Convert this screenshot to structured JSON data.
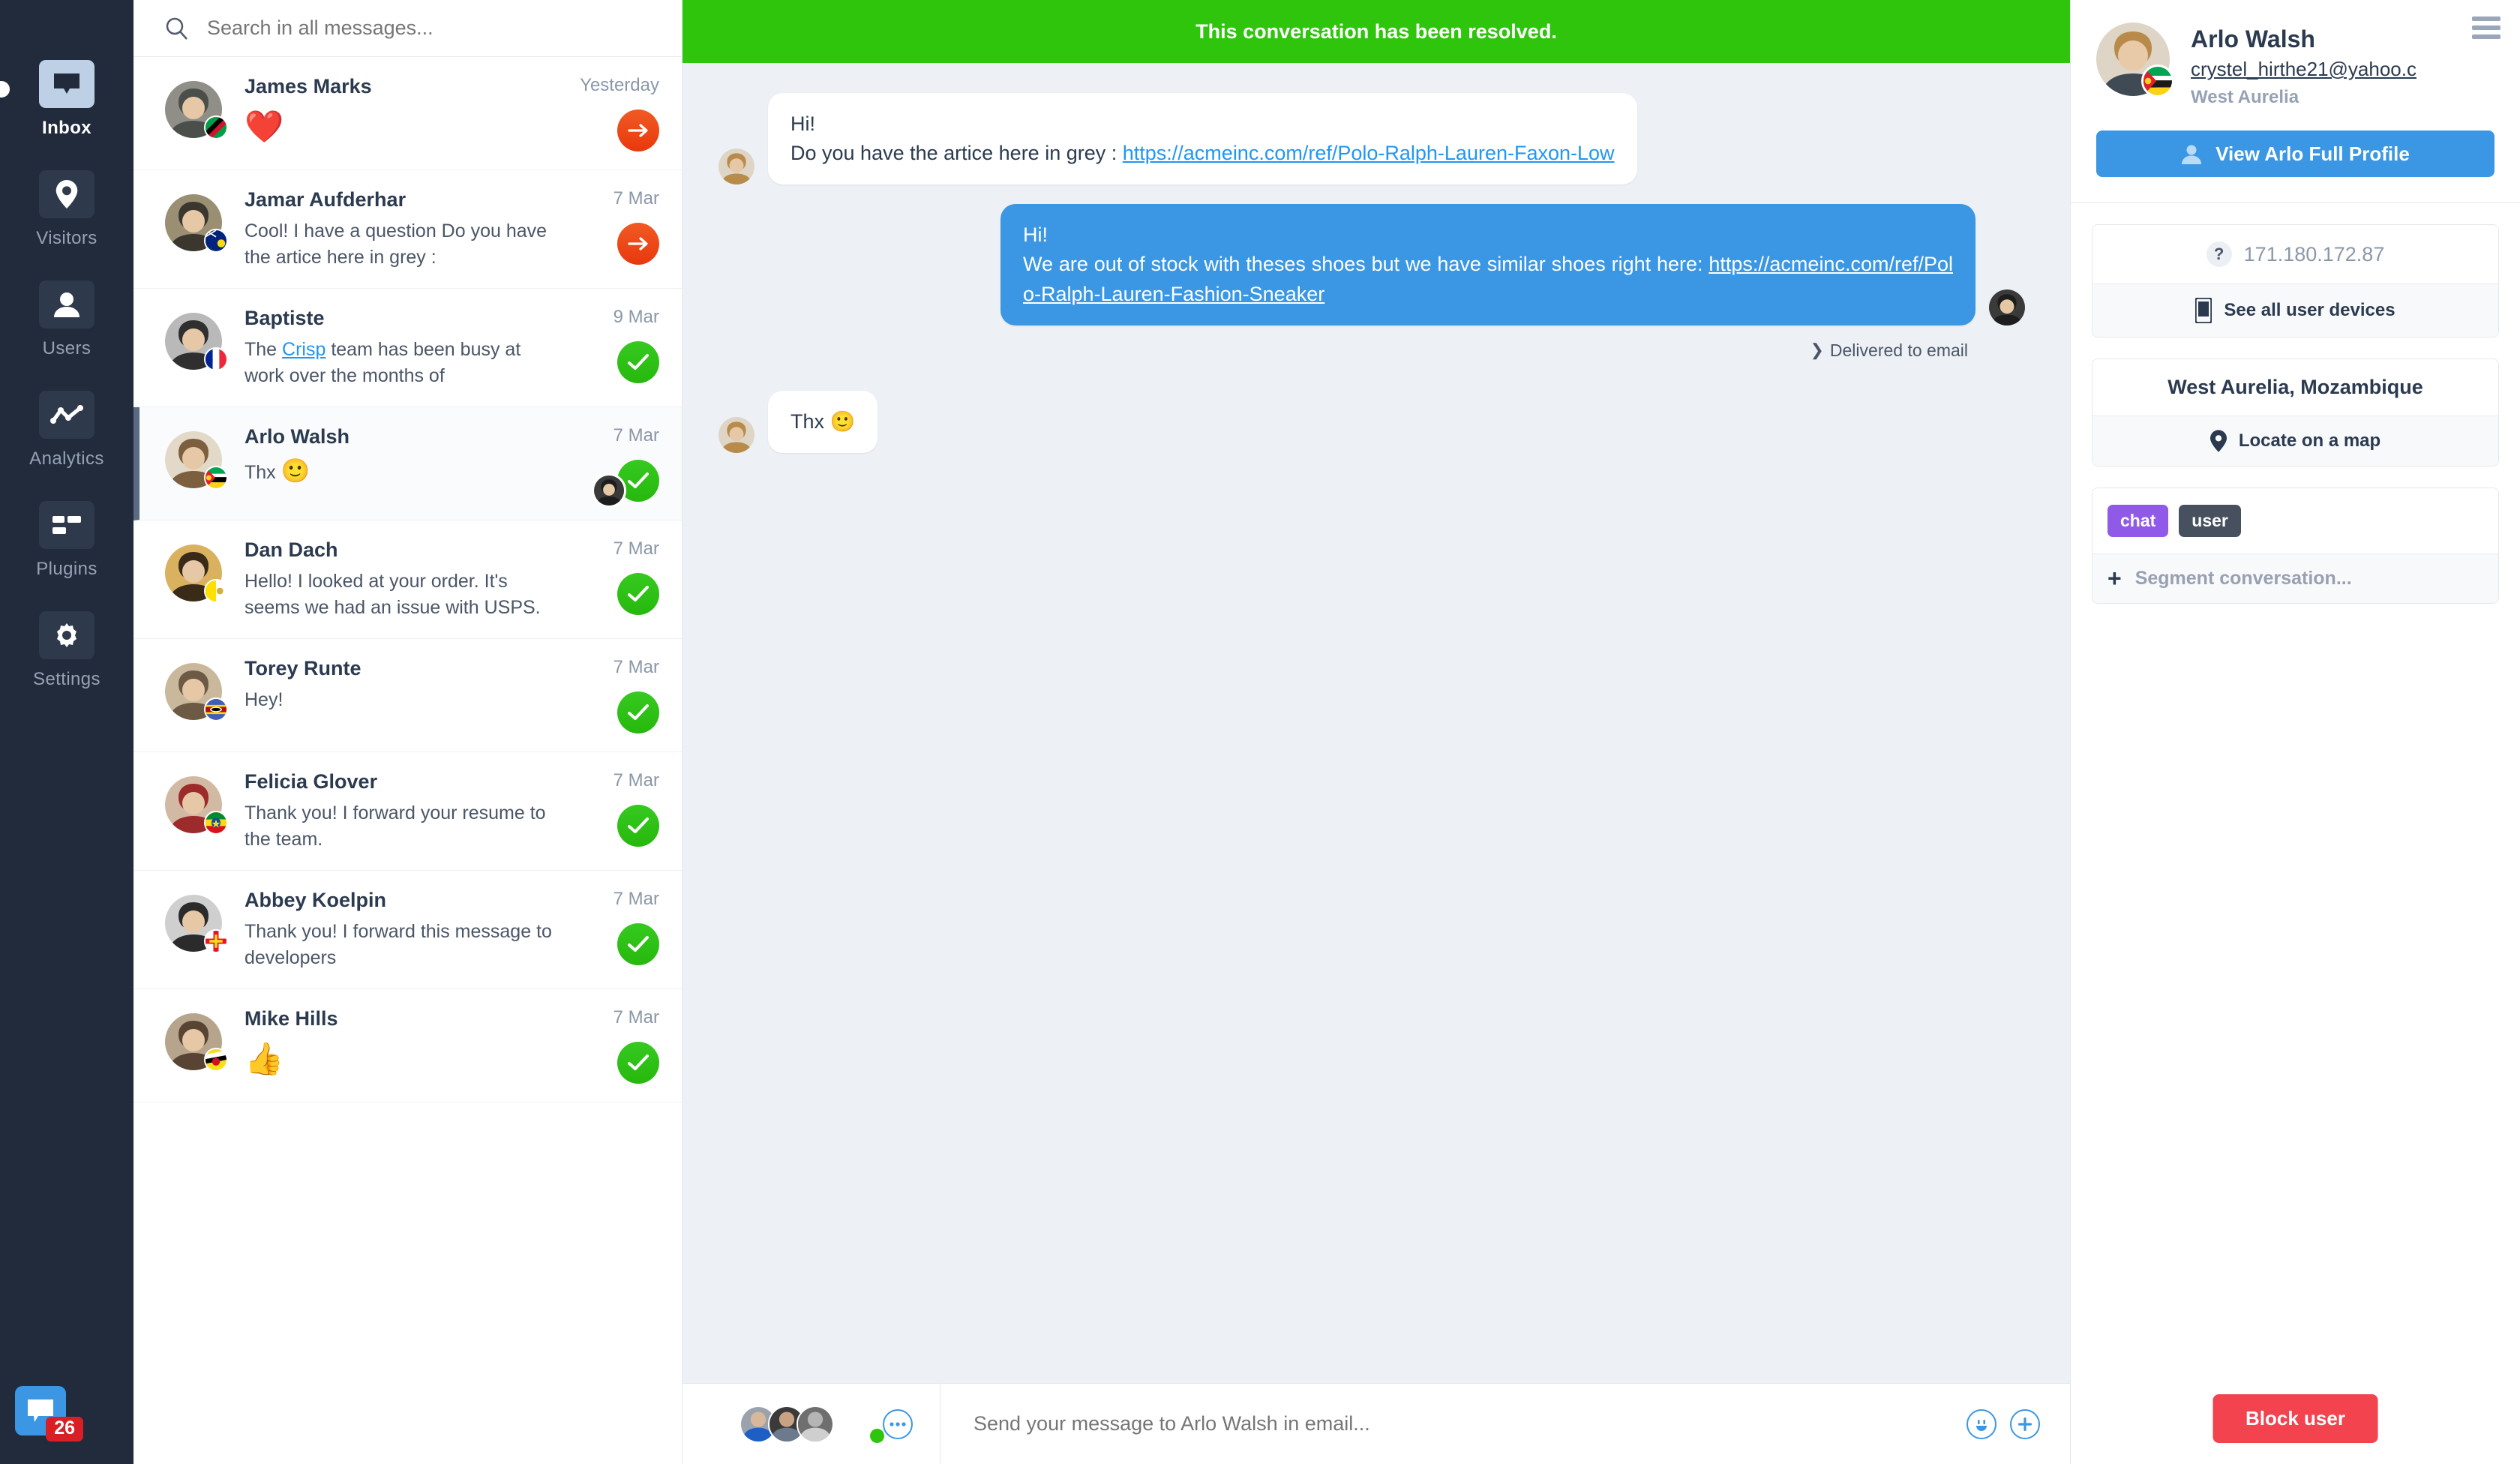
{
  "nav": {
    "items": [
      {
        "label": "Inbox",
        "icon": "inbox-icon",
        "active": true
      },
      {
        "label": "Visitors",
        "icon": "location-pin-icon",
        "active": false
      },
      {
        "label": "Users",
        "icon": "user-icon",
        "active": false
      },
      {
        "label": "Analytics",
        "icon": "analytics-chart-icon",
        "active": false
      },
      {
        "label": "Plugins",
        "icon": "plugins-grid-icon",
        "active": false
      },
      {
        "label": "Settings",
        "icon": "gear-icon",
        "active": false
      }
    ],
    "chat_launcher": {
      "icon": "chat-bubble-icon",
      "badge": "26"
    }
  },
  "search": {
    "placeholder": "Search in all messages...",
    "value": "",
    "icon": "search-icon"
  },
  "conversations": [
    {
      "name": "James Marks",
      "preview": "",
      "emoji": "❤️",
      "date": "Yesterday",
      "status": "pending",
      "selected": false,
      "flag": "Saint Kitts and Nevis",
      "av1": "#8f8e87",
      "av2": "#4a4f4b"
    },
    {
      "name": "Jamar Aufderhar",
      "preview": "Cool! I have a question Do you have the artice here in grey :",
      "emoji": "",
      "date": "7 Mar",
      "status": "pending",
      "selected": false,
      "flag": "Turks and Caicos",
      "av1": "#9a8f73",
      "av2": "#3b372f"
    },
    {
      "name": "Baptiste",
      "preview": "The Crisp team has been busy at work over the months of",
      "link": "Crisp",
      "emoji": "",
      "date": "9 Mar",
      "status": "resolved",
      "selected": false,
      "flag": "France",
      "av1": "#b9b9b9",
      "av2": "#2f2f2f"
    },
    {
      "name": "Arlo Walsh",
      "preview": "Thx",
      "emoji": "🙂",
      "date": "7 Mar",
      "status": "resolved",
      "selected": true,
      "flag": "Mozambique",
      "av1": "#e3d9c9",
      "av2": "#7c5f3e",
      "responder": true
    },
    {
      "name": "Dan Dach",
      "preview": "Hello! I looked at your order. It's seems we had an issue with USPS.",
      "emoji": "",
      "date": "7 Mar",
      "status": "resolved",
      "selected": false,
      "flag": "Vatican City",
      "av1": "#d9b15f",
      "av2": "#3a2a18"
    },
    {
      "name": "Torey Runte",
      "preview": "Hey!",
      "emoji": "",
      "date": "7 Mar",
      "status": "resolved",
      "selected": false,
      "flag": "Eswatini",
      "av1": "#c9b89c",
      "av2": "#6d5a45"
    },
    {
      "name": "Felicia Glover",
      "preview": "Thank you! I forward your resume to the team.",
      "emoji": "",
      "date": "7 Mar",
      "status": "resolved",
      "selected": false,
      "flag": "Ethiopia",
      "av1": "#d2b9a4",
      "av2": "#9d2b2b"
    },
    {
      "name": "Abbey Koelpin",
      "preview": "Thank you! I forward this message to developers",
      "emoji": "",
      "date": "7 Mar",
      "status": "resolved",
      "selected": false,
      "flag": "Guernsey",
      "av1": "#cfcfcf",
      "av2": "#2b2b2b"
    },
    {
      "name": "Mike Hills",
      "preview": "",
      "emoji": "👍",
      "date": "7 Mar",
      "status": "resolved",
      "selected": false,
      "flag": "Brunei",
      "av1": "#b7a48d",
      "av2": "#584433"
    }
  ],
  "conversation": {
    "banner": "This conversation has been resolved.",
    "messages": [
      {
        "direction": "in",
        "line1": "Hi!",
        "line2_prefix": "Do you have the artice here in grey : ",
        "link": "https://acmeinc.com/ref/Polo-Ralph-Lauren-Faxon-Low"
      },
      {
        "direction": "out",
        "line1": "Hi!",
        "line2_prefix": "We are out of stock with theses shoes but we have similar shoes right here: ",
        "link": "https://acmeinc.com/ref/Polo-Ralph-Lauren-Fashion-Sneaker",
        "delivery": "Delivered to email"
      },
      {
        "direction": "in",
        "line1": "Thx 🙂",
        "line2_prefix": "",
        "link": ""
      }
    ]
  },
  "composer": {
    "placeholder": "Send your message to Arlo Walsh in email...",
    "value": "",
    "more_icon": "ellipsis-icon",
    "emoji_icon": "smiley-icon",
    "attach_icon": "plus-icon"
  },
  "panel": {
    "menu_icon": "hamburger-menu-icon",
    "name": "Arlo Walsh",
    "email": "crystel_hirthe21@yahoo.c",
    "location_short": "West Aurelia",
    "profile_button": "View Arlo Full Profile",
    "profile_icon": "user-icon",
    "ip_label": "?",
    "ip_value": "171.180.172.87",
    "devices_label": "See all user devices",
    "devices_icon": "mobile-phone-icon",
    "geo_value": "West Aurelia, Mozambique",
    "map_label": "Locate on a map",
    "map_icon": "location-pin-icon",
    "tags": [
      "chat",
      "user"
    ],
    "segment_placeholder": "Segment conversation...",
    "segment_icon": "plus-icon",
    "block_button": "Block user"
  },
  "colors": {
    "nav_bg": "#212b3b",
    "accent_blue": "#3b97e3",
    "resolved_green": "#2ec50c",
    "pending_orange": "#ef4410",
    "danger_red": "#f2434e",
    "tag_chat_purple": "#9159e8",
    "tag_user_slate": "#46505f",
    "thread_bg": "#edf1f5"
  }
}
